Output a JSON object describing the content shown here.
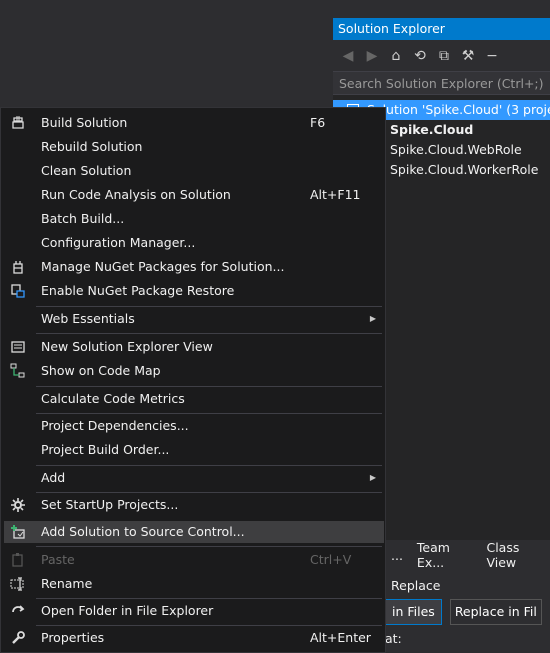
{
  "solution_explorer": {
    "title": "Solution Explorer",
    "search_placeholder": "Search Solution Explorer (Ctrl+;)",
    "tree": [
      {
        "label": "Solution 'Spike.Cloud' (3 projec",
        "selected": true
      },
      {
        "label": "Spike.Cloud",
        "bold": true
      },
      {
        "label": "Spike.Cloud.WebRole"
      },
      {
        "label": "Spike.Cloud.WorkerRole"
      }
    ],
    "bottom_tabs": [
      "...",
      "Team Ex...",
      "Class View"
    ]
  },
  "find_replace": {
    "header": "Replace",
    "in_files": "in Files",
    "replace_in_files": "Replace in Fil",
    "find_label": "at:"
  },
  "context_menu": {
    "items": [
      {
        "label": "Build Solution",
        "shortcut": "F6",
        "icon": "build-icon"
      },
      {
        "label": "Rebuild Solution"
      },
      {
        "label": "Clean Solution"
      },
      {
        "label": "Run Code Analysis on Solution",
        "shortcut": "Alt+F11"
      },
      {
        "label": "Batch Build..."
      },
      {
        "label": "Configuration Manager..."
      },
      {
        "label": "Manage NuGet Packages for Solution...",
        "icon": "nuget-icon"
      },
      {
        "label": "Enable NuGet Package Restore",
        "icon": "package-restore-icon"
      },
      {
        "label": "Web Essentials",
        "submenu": true
      },
      {
        "label": "New Solution Explorer View",
        "icon": "new-view-icon"
      },
      {
        "label": "Show on Code Map",
        "icon": "code-map-icon"
      },
      {
        "label": "Calculate Code Metrics"
      },
      {
        "label": "Project Dependencies..."
      },
      {
        "label": "Project Build Order..."
      },
      {
        "label": "Add",
        "submenu": true
      },
      {
        "label": "Set StartUp Projects...",
        "icon": "gear-icon"
      },
      {
        "label": "Add Solution to Source Control...",
        "icon": "source-control-icon",
        "highlighted": true
      },
      {
        "label": "Paste",
        "shortcut": "Ctrl+V",
        "icon": "paste-icon",
        "disabled": true
      },
      {
        "label": "Rename",
        "icon": "rename-icon"
      },
      {
        "label": "Open Folder in File Explorer",
        "icon": "open-folder-icon"
      },
      {
        "label": "Properties",
        "shortcut": "Alt+Enter",
        "icon": "wrench-icon"
      }
    ]
  },
  "colors": {
    "accent": "#007acc",
    "menu_bg": "#1b1b1c",
    "highlight": "#3e3e40",
    "selection": "#3399ff"
  }
}
